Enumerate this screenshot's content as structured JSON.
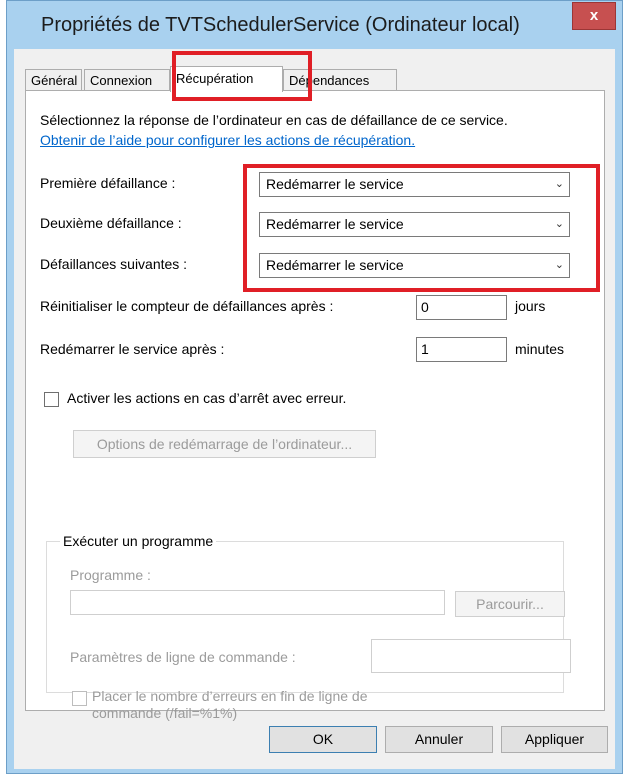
{
  "window": {
    "title": "Propriétés de TVTSchedulerService (Ordinateur local)",
    "close_glyph": "x"
  },
  "tabs": [
    {
      "label": "Général",
      "active": false
    },
    {
      "label": "Connexion",
      "active": false
    },
    {
      "label": "Récupération",
      "active": true
    },
    {
      "label": "Dépendances",
      "active": false
    }
  ],
  "recovery": {
    "intro": "Sélectionnez la réponse de l’ordinateur en cas de défaillance de ce service.",
    "help_link": "Obtenir de l’aide pour configurer les actions de récupération.",
    "first_failure": {
      "label": "Première défaillance :",
      "value": "Redémarrer le service"
    },
    "second_failure": {
      "label": "Deuxième défaillance :",
      "value": "Redémarrer le service"
    },
    "subsequent_failures": {
      "label": "Défaillances suivantes :",
      "value": "Redémarrer le service"
    },
    "reset_counter": {
      "label": "Réinitialiser le compteur de défaillances après :",
      "value": "0",
      "unit": "jours"
    },
    "restart_service": {
      "label": "Redémarrer le service après :",
      "value": "1",
      "unit": "minutes"
    },
    "enable_actions": {
      "label": "Activer les actions en cas d’arrêt avec erreur.",
      "checked": false
    },
    "restart_options_button": "Options de redémarrage de l’ordinateur...",
    "run_program": {
      "group_label": "Exécuter un programme",
      "program_label": "Programme :",
      "program_value": "",
      "browse_button": "Parcourir...",
      "params_label": "Paramètres de ligne de commande :",
      "params_value": "",
      "append_fail_count": {
        "label_line1": "Placer le nombre d’erreurs en fin de ligne de",
        "label_line2": "commande (/fail=%1%)",
        "checked": false
      }
    }
  },
  "buttons": {
    "ok": "OK",
    "cancel": "Annuler",
    "apply": "Appliquer"
  },
  "colors": {
    "highlight": "#e01f26",
    "link": "#0066cc",
    "title_bar": "#a9d1ef",
    "close_button": "#c75050"
  }
}
